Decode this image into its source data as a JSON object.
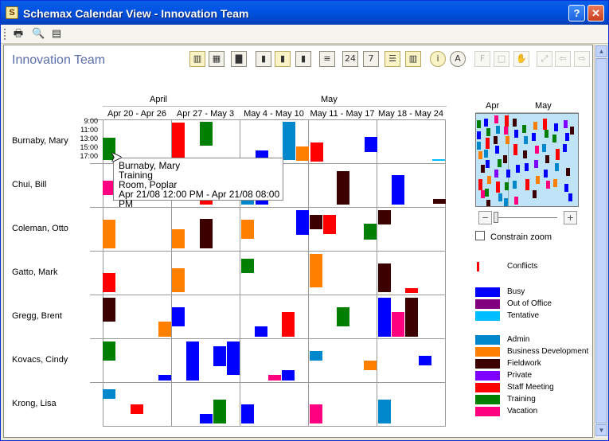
{
  "window": {
    "title": "Schemax Calendar View - Innovation Team",
    "help_label": "?",
    "close_label": "✕",
    "app_icon_letter": "S"
  },
  "toolbar": {
    "items": [
      {
        "name": "print-icon",
        "glyph": "🖶"
      },
      {
        "name": "print-preview-icon",
        "glyph": "🔍"
      },
      {
        "name": "export-icon",
        "glyph": "▤"
      }
    ]
  },
  "header": {
    "team_name": "Innovation Team"
  },
  "view_buttons": [
    {
      "name": "view-resource-button",
      "glyph": "▥",
      "state": "active"
    },
    {
      "name": "view-columns-button",
      "glyph": "▦",
      "state": "normal"
    },
    {
      "name": "view-bars-button",
      "glyph": "▇",
      "state": "normal"
    },
    {
      "name": "view-colored-bars-button",
      "glyph": "▮",
      "state": "normal"
    },
    {
      "name": "view-colored-bars-active-button",
      "glyph": "▮",
      "state": "active"
    },
    {
      "name": "view-colored-bars-2-button",
      "glyph": "▮",
      "state": "normal"
    },
    {
      "name": "layers-button",
      "glyph": "≡",
      "state": "normal"
    },
    {
      "name": "day-24-button",
      "glyph": "24",
      "state": "normal"
    },
    {
      "name": "day-7-button",
      "glyph": "7",
      "state": "normal"
    },
    {
      "name": "row-lines-button",
      "glyph": "☰",
      "state": "active"
    },
    {
      "name": "column-lines-button",
      "glyph": "▥",
      "state": "active"
    },
    {
      "name": "info-button",
      "glyph": "i",
      "state": "active"
    },
    {
      "name": "a-button",
      "glyph": "A",
      "state": "normal"
    },
    {
      "name": "font-button",
      "glyph": "F",
      "state": "disabled"
    },
    {
      "name": "select-button",
      "glyph": "□",
      "state": "disabled"
    },
    {
      "name": "hand-button",
      "glyph": "✋",
      "state": "disabled"
    },
    {
      "name": "expand-button",
      "glyph": "⤢",
      "state": "disabled"
    },
    {
      "name": "back-button",
      "glyph": "⇦",
      "state": "disabled"
    },
    {
      "name": "forward-button",
      "glyph": "⇨",
      "state": "disabled"
    }
  ],
  "calendar": {
    "months": [
      "April",
      "May"
    ],
    "weeks": [
      "Apr 20 - Apr 26",
      "Apr 27 - May 3",
      "May 4 - May 10",
      "May 11 - May 17",
      "May 18 - May 24"
    ],
    "hours": [
      "9:00",
      "11:00",
      "13:00",
      "15:00",
      "17:00"
    ],
    "people": [
      "Burnaby, Mary",
      "Chui, Bill",
      "Coleman, Otto",
      "Gatto, Mark",
      "Gregg, Brent",
      "Kovacs, Cindy",
      "Krong, Lisa"
    ]
  },
  "tooltip": {
    "line1": "Burnaby, Mary",
    "line2": "Training",
    "line3": "Room, Poplar",
    "line4": "Apr 21/08 12:00 PM - Apr 21/08 08:00 PM"
  },
  "side_panel": {
    "overview_months": [
      "Apr",
      "May"
    ],
    "zoom_minus": "−",
    "zoom_plus": "+",
    "constrain_zoom_label": "Constrain zoom",
    "legend": [
      {
        "label": "Conflicts",
        "color": "#FF0000"
      },
      {
        "label": "Busy",
        "color": "#0000FF"
      },
      {
        "label": "Out of Office",
        "color": "#800080"
      },
      {
        "label": "Tentative",
        "color": "#00BFFF"
      },
      {
        "label": "Admin",
        "color": "#0087CC"
      },
      {
        "label": "Business Development",
        "color": "#FF8000"
      },
      {
        "label": "Fieldwork",
        "color": "#3C0000"
      },
      {
        "label": "Private",
        "color": "#8000FF"
      },
      {
        "label": "Staff Meeting",
        "color": "#FF0000"
      },
      {
        "label": "Training",
        "color": "#007F00"
      },
      {
        "label": "Vacation",
        "color": "#FF0080"
      }
    ]
  },
  "scroll": {
    "up_label": "▲",
    "down_label": "▼"
  }
}
